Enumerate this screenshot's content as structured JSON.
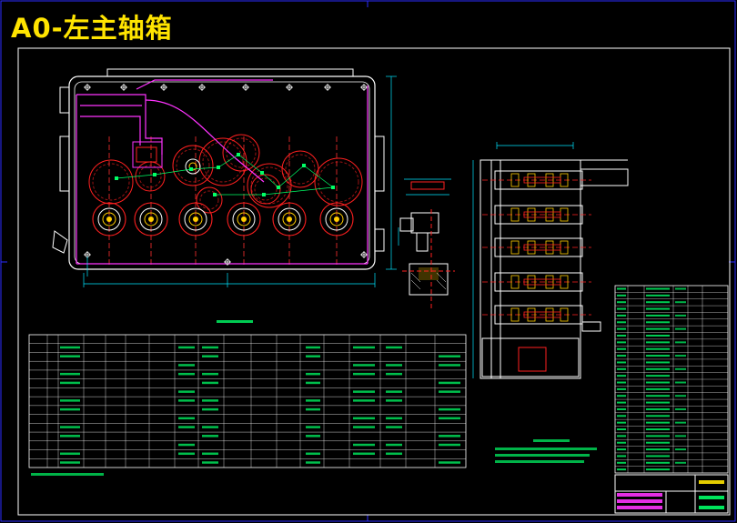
{
  "drawing": {
    "title": "A0-左主轴箱",
    "colors": {
      "title": "#ffe400",
      "frame": "#ffffff",
      "border": "#2b2bff",
      "outline": "#ffffff",
      "gear": "#ff2020",
      "shaft_path": "#ff33ff",
      "dimension": "#00e4ff",
      "node": "#00ff66",
      "table_line": "#ffffff",
      "table_text": "#00ff66"
    }
  }
}
